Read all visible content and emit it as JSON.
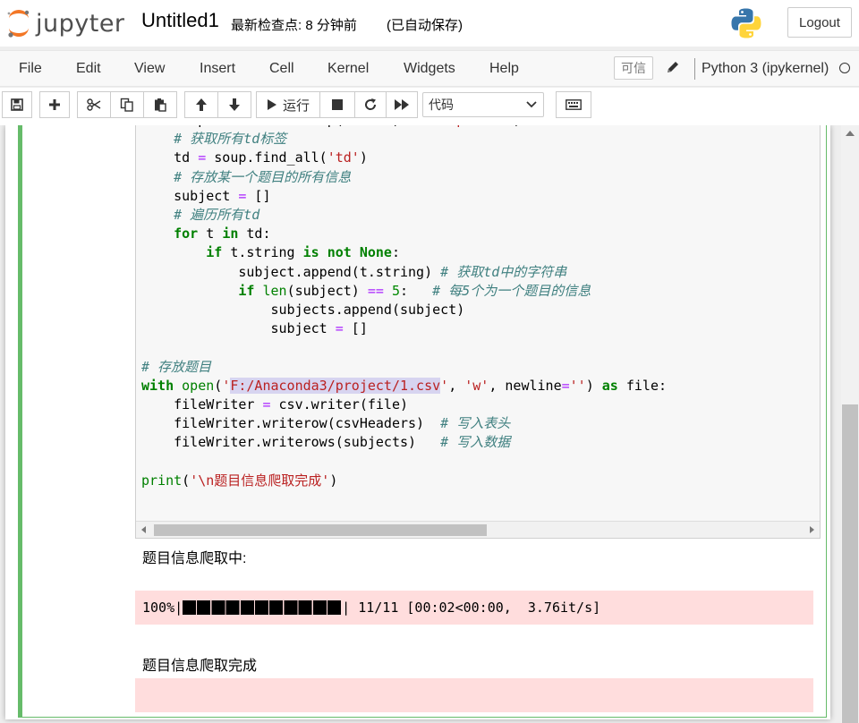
{
  "header": {
    "logo_text": "jupyter",
    "notebook_name": "Untitled1",
    "checkpoint": "最新检查点: 8 分钟前",
    "autosave": "(已自动保存)",
    "logout_label": "Logout"
  },
  "menubar": {
    "items": [
      "File",
      "Edit",
      "View",
      "Insert",
      "Cell",
      "Kernel",
      "Widgets",
      "Help"
    ],
    "trusted_label": "可信",
    "kernel_name": "Python 3 (ipykernel)"
  },
  "toolbar": {
    "run_label": "运行",
    "cell_type": "代码"
  },
  "code": {
    "lines": [
      "    soup = BeautifulSoup(r.text, 'html.parser')",
      "    # 获取所有td标签",
      "    td = soup.find_all('td')",
      "    # 存放某一个题目的所有信息",
      "    subject = []",
      "    # 遍历所有td",
      "    for t in td:",
      "        if t.string is not None:",
      "            subject.append(t.string) # 获取td中的字符串",
      "            if len(subject) == 5:   # 每5个为一个题目的信息",
      "                subjects.append(subject)",
      "                subject = []",
      "",
      "# 存放题目",
      "with open('F:/Anaconda3/project/1.csv', 'w', newline='') as file:",
      "    fileWriter = csv.writer(file)",
      "    fileWriter.writerow(csvHeaders)  # 写入表头",
      "    fileWriter.writerows(subjects)   # 写入数据",
      "",
      "print('\\n题目信息爬取完成')"
    ]
  },
  "output": {
    "line1": "题目信息爬取中:",
    "progress_percent": "100%",
    "progress_fraction": 1.0,
    "progress_rest": "| 11/11 [00:02<00:00,  3.76it/s]",
    "line2": "题目信息爬取完成"
  }
}
